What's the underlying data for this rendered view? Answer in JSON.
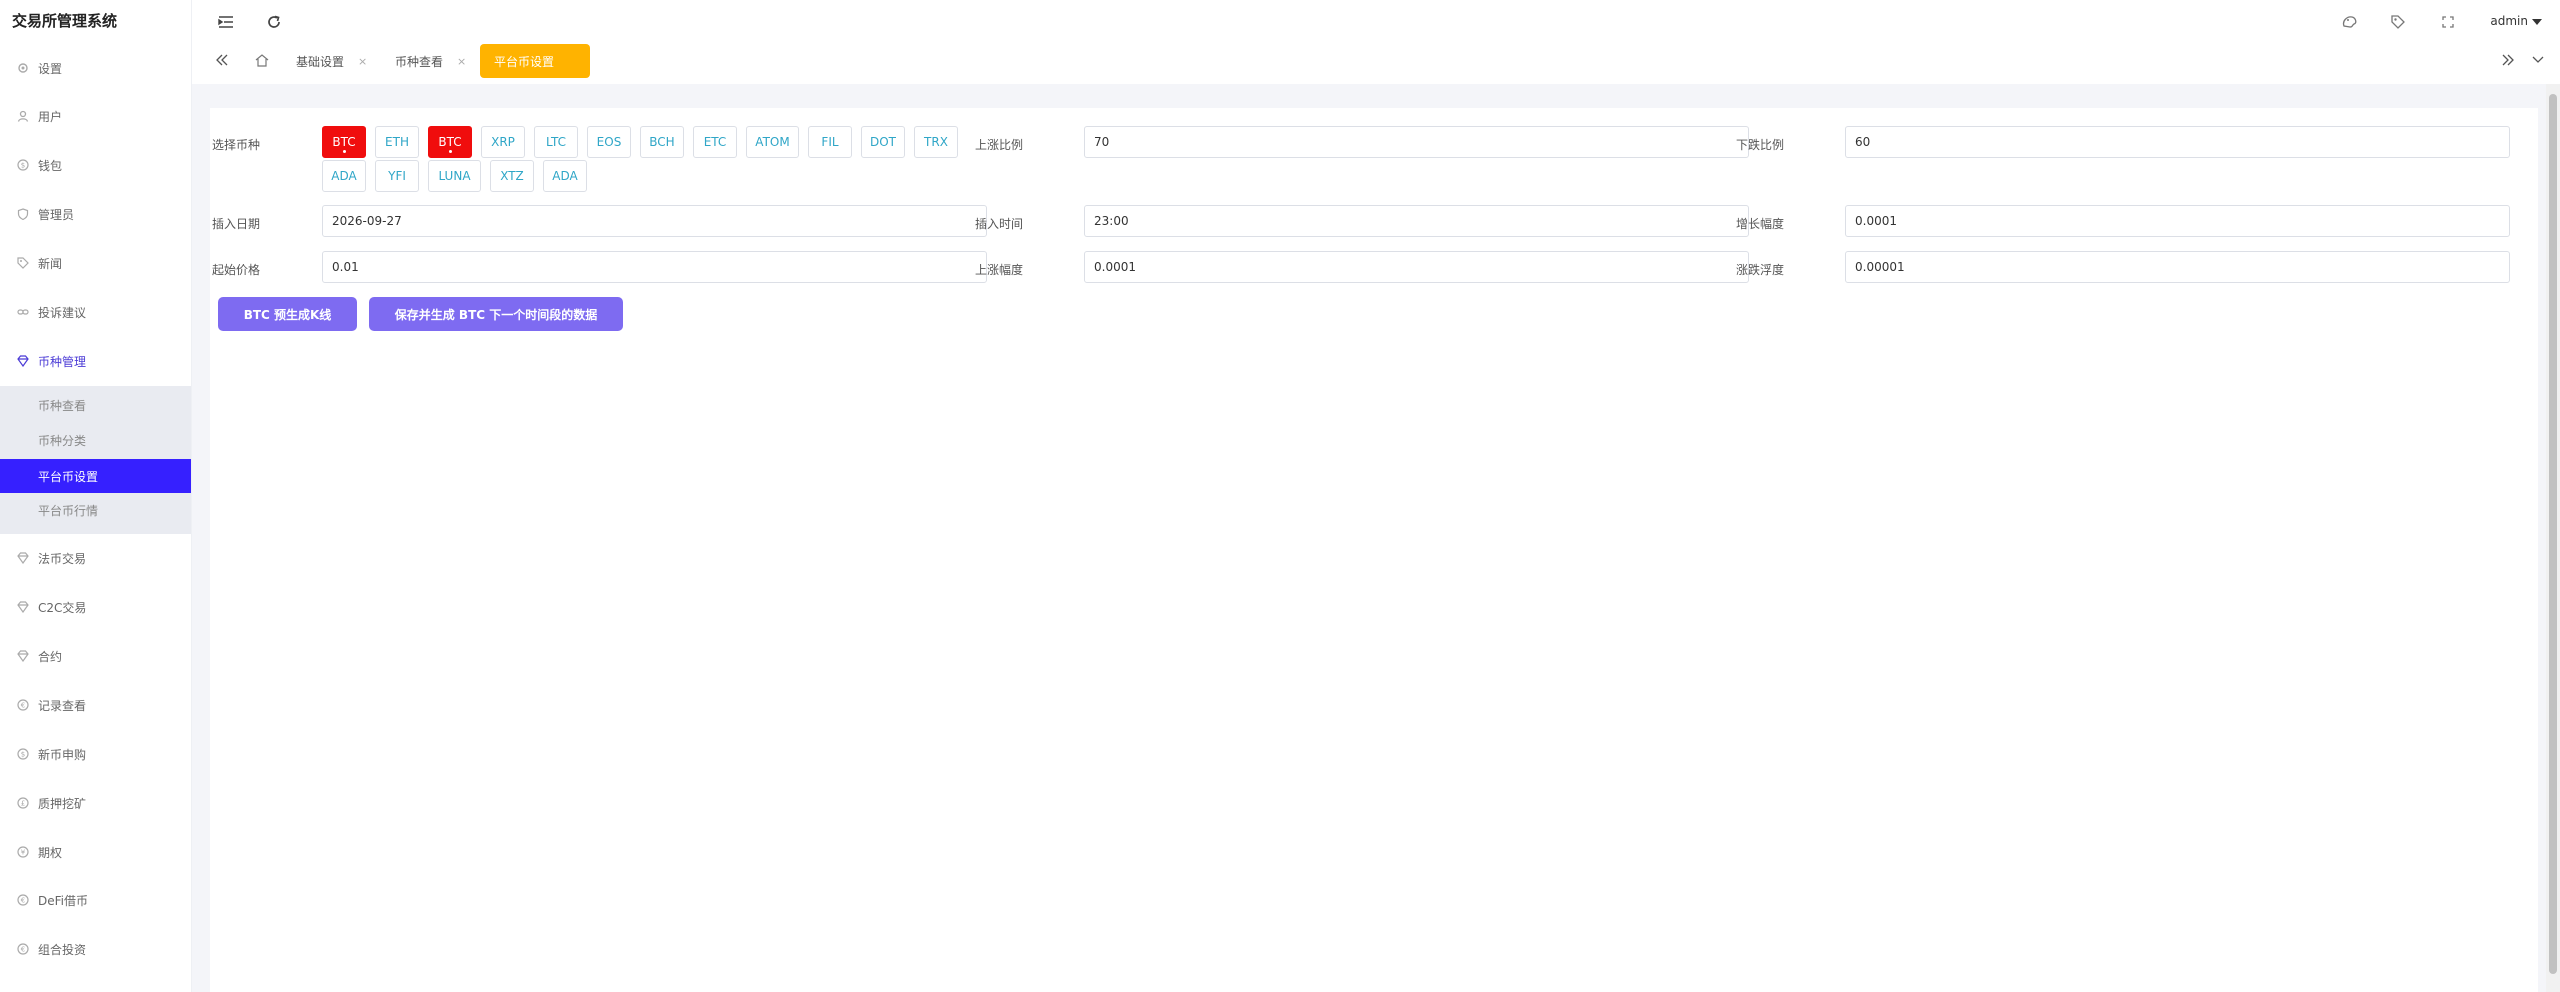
{
  "app": {
    "title": "交易所管理系统"
  },
  "sidebar": {
    "items": [
      {
        "label": "设置",
        "icon": "gear-icon"
      },
      {
        "label": "用户",
        "icon": "user-icon"
      },
      {
        "label": "钱包",
        "icon": "wallet-icon"
      },
      {
        "label": "管理员",
        "icon": "shield-icon"
      },
      {
        "label": "新闻",
        "icon": "tag-icon"
      },
      {
        "label": "投诉建议",
        "icon": "link-icon"
      },
      {
        "label": "币种管理",
        "icon": "diamond-icon"
      },
      {
        "label": "法币交易",
        "icon": "diamond-icon"
      },
      {
        "label": "C2C交易",
        "icon": "diamond-icon"
      },
      {
        "label": "合约",
        "icon": "diamond-icon"
      },
      {
        "label": "记录查看",
        "icon": "currency-icon"
      },
      {
        "label": "新币申购",
        "icon": "currency-icon"
      },
      {
        "label": "质押挖矿",
        "icon": "currency-icon"
      },
      {
        "label": "期权",
        "icon": "currency-icon"
      },
      {
        "label": "DeFi借币",
        "icon": "currency-icon"
      },
      {
        "label": "组合投资",
        "icon": "currency-icon"
      }
    ],
    "submenu": [
      {
        "label": "币种查看"
      },
      {
        "label": "币种分类"
      },
      {
        "label": "平台币设置"
      },
      {
        "label": "平台币行情"
      }
    ]
  },
  "topbar": {
    "user": "admin"
  },
  "tabs": [
    {
      "label": "基础设置"
    },
    {
      "label": "币种查看"
    },
    {
      "label": "平台币设置"
    }
  ],
  "form": {
    "coin_label": "选择币种",
    "coins_row1": [
      "BTC",
      "ETH",
      "BTC",
      "XRP",
      "LTC",
      "EOS",
      "BCH",
      "ETC",
      "ATOM",
      "FIL",
      "DOT",
      "TRX"
    ],
    "coins_row2": [
      "ADA",
      "YFI",
      "LUNA",
      "XTZ",
      "ADA"
    ],
    "up_ratio_label": "上涨比例",
    "up_ratio": "70",
    "down_ratio_label": "下跌比例",
    "down_ratio": "60",
    "insert_date_label": "插入日期",
    "insert_date": "2026-09-27",
    "insert_time_label": "插入时间",
    "insert_time": "23:00",
    "growth_label": "增长幅度",
    "growth": "0.0001",
    "start_price_label": "起始价格",
    "start_price": "0.01",
    "rise_label": "上涨幅度",
    "rise": "0.0001",
    "fluct_label": "涨跌浮度",
    "fluct": "0.00001",
    "btn_preview": "BTC 预生成K线",
    "btn_save": "保存并生成 BTC 下一个时间段的数据"
  }
}
